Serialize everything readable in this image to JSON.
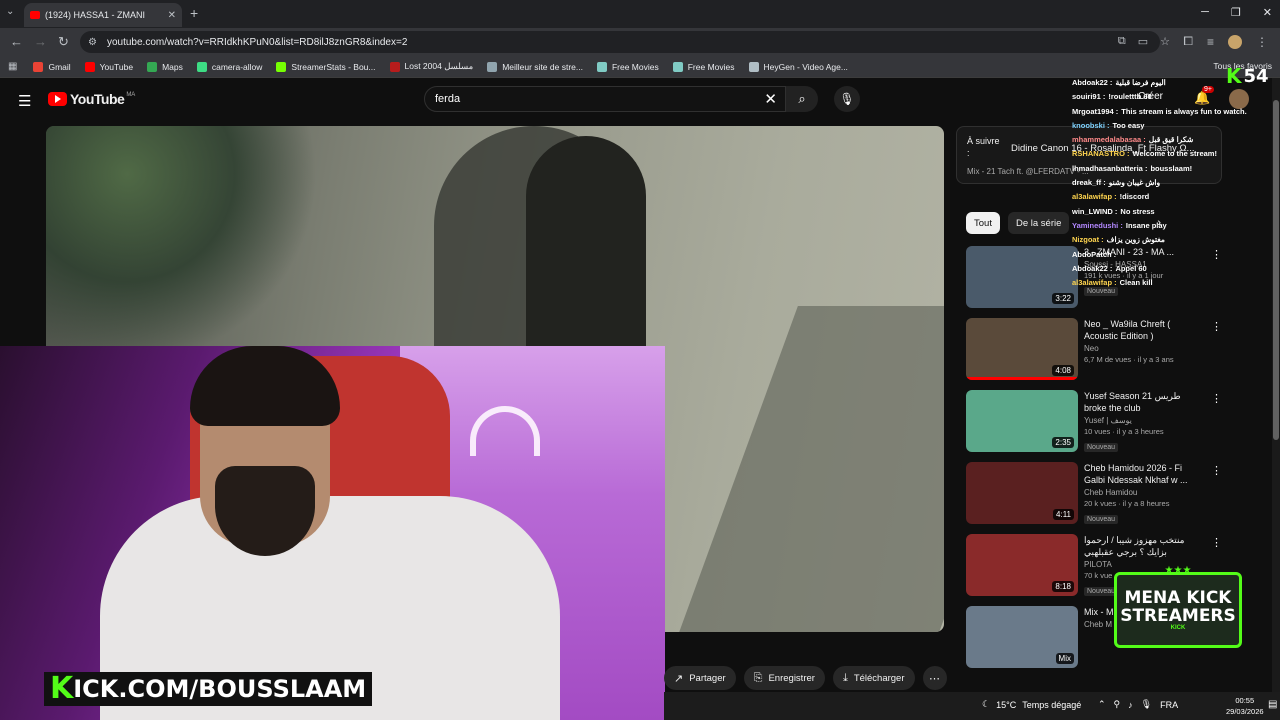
{
  "browser": {
    "tab_title": "(1924) HASSA1 - ZMANI",
    "url": "youtube.com/watch?v=RRIdkhKPuN0&list=RD8ilJ8znGR8&index=2",
    "all_bookmarks": "Tous les favoris"
  },
  "bookmarks": [
    {
      "label": "Gmail",
      "color": "#ea4335"
    },
    {
      "label": "YouTube",
      "color": "#ff0000"
    },
    {
      "label": "Maps",
      "color": "#34a853"
    },
    {
      "label": "camera-allow",
      "color": "#3ddc84"
    },
    {
      "label": "StreamerStats - Bou...",
      "color": "#76ff03"
    },
    {
      "label": "Lost 2004 مسلسل",
      "color": "#b71c1c"
    },
    {
      "label": "Meilleur site de stre...",
      "color": "#90a4ae"
    },
    {
      "label": "Free Movies",
      "color": "#80cbc4"
    },
    {
      "label": "Free Movies",
      "color": "#80cbc4"
    },
    {
      "label": "HeyGen - Video Age...",
      "color": "#b0bec5"
    }
  ],
  "youtube": {
    "logo": "YouTube",
    "country": "MA",
    "search_value": "ferda",
    "create_label": "Créer",
    "notif_count": "9+"
  },
  "upnext": {
    "label": "À suivre :",
    "title": "Didine Canon 16 - Rosalinda_Ft Flashy Ω...",
    "subtitle": "Mix - 21 Tach ft. @LFERDATV - ..."
  },
  "chips": {
    "all": "Tout",
    "series": "De la série"
  },
  "recommendations": [
    {
      "title": "3 - ZMANI - 23 - MA ...",
      "channel": "Soussi - HASSA1",
      "views": "191 k vues · il y a 1 jour",
      "badge": "Nouveau",
      "duration": "3:22",
      "thumb": "#4a5a6a",
      "progress": 0
    },
    {
      "title": "Neo _ Wa9ila Chreft ( Acoustic Edition )",
      "channel": "Neo",
      "views": "6,7 M de vues · il y a 3 ans",
      "badge": "",
      "duration": "4:08",
      "thumb": "#5a4a3a",
      "progress": 1.0
    },
    {
      "title": "Yusef Season 21 طريس broke the club",
      "channel": "Yusef | يوسف",
      "views": "10 vues · il y a 3 heures",
      "badge": "Nouveau",
      "duration": "2:35",
      "thumb": "#5aa88a",
      "progress": 0
    },
    {
      "title": "Cheb Hamidou 2026 - Fi Galbi Ndessak Nkhaf w ...",
      "channel": "Cheb Hamidou",
      "views": "20 k vues · il y a 8 heures",
      "badge": "Nouveau",
      "duration": "4:11",
      "thumb": "#5a2020",
      "progress": 0
    },
    {
      "title": "منتخب مهزوز شيبا / ارحموا بزايك ؟ برجي عقبلهبي",
      "channel": "PILOTA",
      "views": "70 k vue",
      "badge": "Nouveau",
      "duration": "8:18",
      "thumb": "#8a2a2a",
      "progress": 0
    },
    {
      "title": "Mix - M",
      "channel": "Cheb M",
      "views": "",
      "badge": "",
      "duration": "Mix",
      "thumb": "#6a7a8a",
      "progress": 0
    }
  ],
  "actions": {
    "share": "Partager",
    "save": "Enregistrer",
    "download": "Télécharger"
  },
  "stream": {
    "kick_count": "54",
    "banner_k": "K",
    "banner_text": "ICK.COM/BOUSSLAAM",
    "mena_line1": "MENA KICK",
    "mena_line2": "STREAMERS",
    "mena_kick": "KICK"
  },
  "chat": [
    {
      "user": "Abdoak22 :",
      "msg": "اليوم فرضا قبلية",
      "color": "#ffffff"
    },
    {
      "user": "souiri91 :",
      "msg": "!rouletttb 60",
      "color": "#ffffff"
    },
    {
      "user": "Mrgoat1994 :",
      "msg": "This stream is always fun to watch.",
      "color": "#ffffff"
    },
    {
      "user": "knoobski :",
      "msg": "Too easy",
      "color": "#7fd3ff"
    },
    {
      "user": "mhammedalabasaa :",
      "msg": "شكرا قيق قبل",
      "color": "#ff8a8a"
    },
    {
      "user": "RSHANASTRO :",
      "msg": "Welcome to the stream!",
      "color": "#ffd54f"
    },
    {
      "user": "lhmadhasanbatteria :",
      "msg": "bousslaam!",
      "color": "#ffffff"
    },
    {
      "user": "dreak_ff :",
      "msg": "واش غيبان وشنو",
      "color": "#ffffff"
    },
    {
      "user": "al3alawifap :",
      "msg": "!discord",
      "color": "#ffd54f"
    },
    {
      "user": "win_LWIND :",
      "msg": "No stress",
      "color": "#ffffff"
    },
    {
      "user": "Yaminedushi :",
      "msg": "Insane play",
      "color": "#b388ff"
    },
    {
      "user": "Nizgoat :",
      "msg": "مغتوش زوين يزاف",
      "color": "#ffd54f"
    },
    {
      "user": "AbdoPatch :",
      "msg": "",
      "color": "#ffffff"
    },
    {
      "user": "Abdoak22 :",
      "msg": "Appel 60",
      "color": "#ffffff"
    },
    {
      "user": "al3alawifap :",
      "msg": "Clean kill",
      "color": "#ffd54f"
    }
  ],
  "taskbar": {
    "temp": "15°C",
    "weather": "Temps dégagé",
    "lang": "FRA",
    "time": "00:55",
    "date": "29/03/2026"
  }
}
